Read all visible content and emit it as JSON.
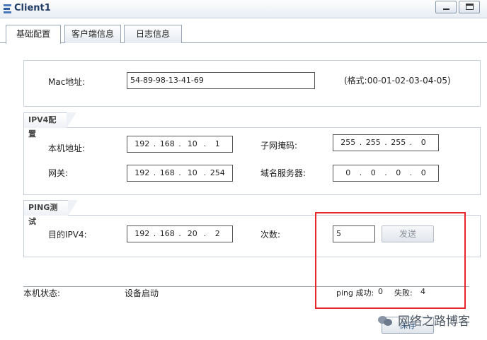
{
  "window": {
    "title": "Client1"
  },
  "tabs": [
    "基础配置",
    "客户端信息",
    "日志信息"
  ],
  "mac": {
    "label": "Mac地址:",
    "value": "54-89-98-13-41-69",
    "format_hint": "(格式:00-01-02-03-04-05)"
  },
  "ipv4": {
    "section_title": "IPV4配置",
    "local_ip_label": "本机地址:",
    "local_ip": [
      "192",
      "168",
      "10",
      "1"
    ],
    "mask_label": "子网掩码:",
    "mask": [
      "255",
      "255",
      "255",
      "0"
    ],
    "gateway_label": "网关:",
    "gateway": [
      "192",
      "168",
      "10",
      "254"
    ],
    "dns_label": "域名服务器:",
    "dns": [
      "0",
      "0",
      "0",
      "0"
    ]
  },
  "ping": {
    "section_title": "PING测试",
    "target_label": "目的IPV4:",
    "target": [
      "192",
      "168",
      "20",
      "2"
    ],
    "count_label": "次数:",
    "count": "5",
    "send_label": "发送"
  },
  "status": {
    "label": "本机状态:",
    "value": "设备启动",
    "ping_success_label": "ping 成功:",
    "ping_success": "0",
    "fail_label": "失败:",
    "fail": "4"
  },
  "save_label": "保存",
  "watermark": "网络之路博客",
  "colors": {
    "highlight": "#e8262a",
    "title": "#1f3b63"
  }
}
